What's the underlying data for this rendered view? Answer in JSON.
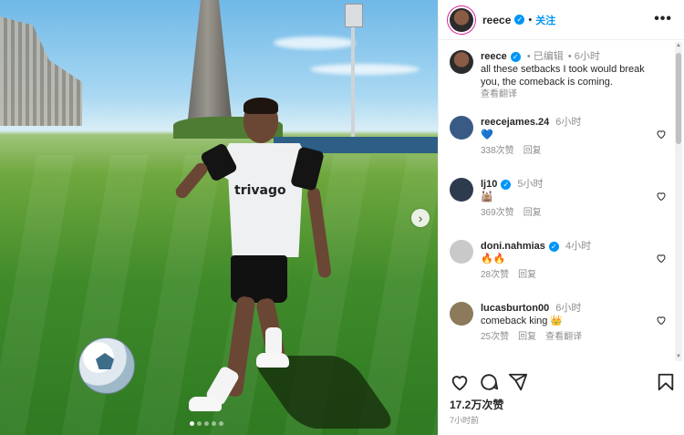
{
  "post": {
    "username": "reece",
    "follow_sep": "•",
    "follow_label": "关注",
    "more": "•••",
    "caption": {
      "name": "reece",
      "edited": "• 已编辑",
      "time": "• 6小时",
      "text": "all these setbacks I took would break you, the comeback is coming.",
      "translate": "查看翻译"
    },
    "photo": {
      "sponsor_text": "trivago",
      "next_label": "›"
    },
    "likes": "17.2万次赞",
    "ago": "7小时前"
  },
  "comments": [
    {
      "name": "reecejames.24",
      "time": "6小时",
      "text": "💙",
      "likes": "338次赞",
      "reply": "回复",
      "translate": "",
      "avatar_color": "#3a5a86"
    },
    {
      "name": "lj10",
      "time": "5小时",
      "text": "🕍",
      "likes": "369次赞",
      "reply": "回复",
      "translate": "",
      "avatar_color": "#2e3b4e"
    },
    {
      "name": "doni.nahmias",
      "time": "4小时",
      "text": "🔥🔥",
      "likes": "28次赞",
      "reply": "回复",
      "translate": "",
      "avatar_color": "#c9c9c9"
    },
    {
      "name": "lucasburton00",
      "time": "6小时",
      "text": "comeback king 👑",
      "likes": "25次赞",
      "reply": "回复",
      "translate": "查看翻译",
      "avatar_color": "#8c7a5a"
    }
  ],
  "colors": {
    "accent": "#0095f6",
    "muted": "#8e8e8e",
    "text": "#262626"
  },
  "icons": [
    "heart-icon",
    "comment-icon",
    "share-icon",
    "bookmark-icon",
    "more-icon",
    "verified-icon"
  ]
}
